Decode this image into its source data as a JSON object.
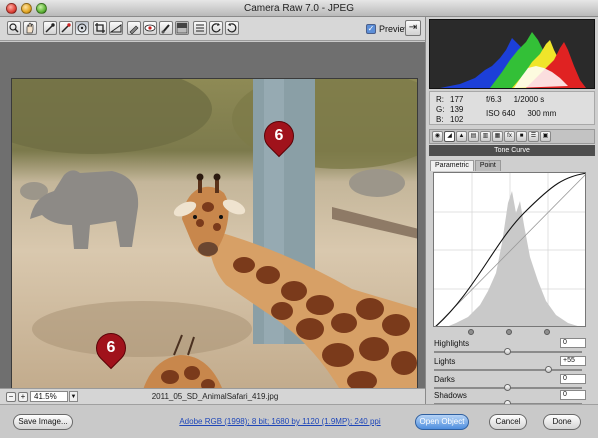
{
  "window": {
    "title": "Camera Raw 7.0  -  JPEG"
  },
  "toolbar": {
    "tools": [
      {
        "name": "zoom-tool",
        "icon": "magnifier-icon"
      },
      {
        "name": "hand-tool",
        "icon": "hand-icon"
      },
      {
        "name": "white-balance-tool",
        "icon": "eyedropper-icon"
      },
      {
        "name": "color-sampler-tool",
        "icon": "color-sampler-icon"
      },
      {
        "name": "targeted-adjustment-tool",
        "icon": "target-adjust-icon"
      },
      {
        "name": "crop-tool",
        "icon": "crop-icon"
      },
      {
        "name": "straighten-tool",
        "icon": "straighten-icon"
      },
      {
        "name": "spot-removal-tool",
        "icon": "spot-removal-icon"
      },
      {
        "name": "red-eye-tool",
        "icon": "red-eye-icon"
      },
      {
        "name": "adjustment-brush-tool",
        "icon": "brush-icon"
      },
      {
        "name": "graduated-filter-tool",
        "icon": "gradient-icon"
      },
      {
        "name": "preferences-button",
        "icon": "preferences-icon"
      },
      {
        "name": "rotate-left-button",
        "icon": "rotate-ccw-icon"
      },
      {
        "name": "rotate-right-button",
        "icon": "rotate-cw-icon"
      }
    ],
    "preview_label": "Preview",
    "preview_checked": true
  },
  "callouts": [
    "6",
    "6"
  ],
  "status": {
    "zoom_value": "41.5%",
    "filename": "2011_05_SD_AnimalSafari_419.jpg"
  },
  "readout": {
    "r_label": "R:",
    "r_value": "177",
    "g_label": "G:",
    "g_value": "139",
    "b_label": "B:",
    "b_value": "102",
    "aperture": "f/6.3",
    "shutter": "1/2000 s",
    "iso": "ISO 640",
    "focal": "300 mm"
  },
  "panel": {
    "section_title": "Tone Curve",
    "subtabs": [
      "Parametric",
      "Point"
    ],
    "sliders": [
      {
        "label": "Highlights",
        "value": "0",
        "level": 0.5
      },
      {
        "label": "Lights",
        "value": "+55",
        "level": 0.775
      },
      {
        "label": "Darks",
        "value": "0",
        "level": 0.5
      },
      {
        "label": "Shadows",
        "value": "0",
        "level": 0.5
      }
    ]
  },
  "footer": {
    "save_label": "Save Image...",
    "workflow_link": "Adobe RGB (1998); 8 bit; 1680 by 1120 (1.9MP); 240 ppi",
    "open_label": "Open Object",
    "cancel_label": "Cancel",
    "done_label": "Done"
  },
  "colors": {
    "accent": "#4f8fdf",
    "callout": "#a0121b"
  }
}
